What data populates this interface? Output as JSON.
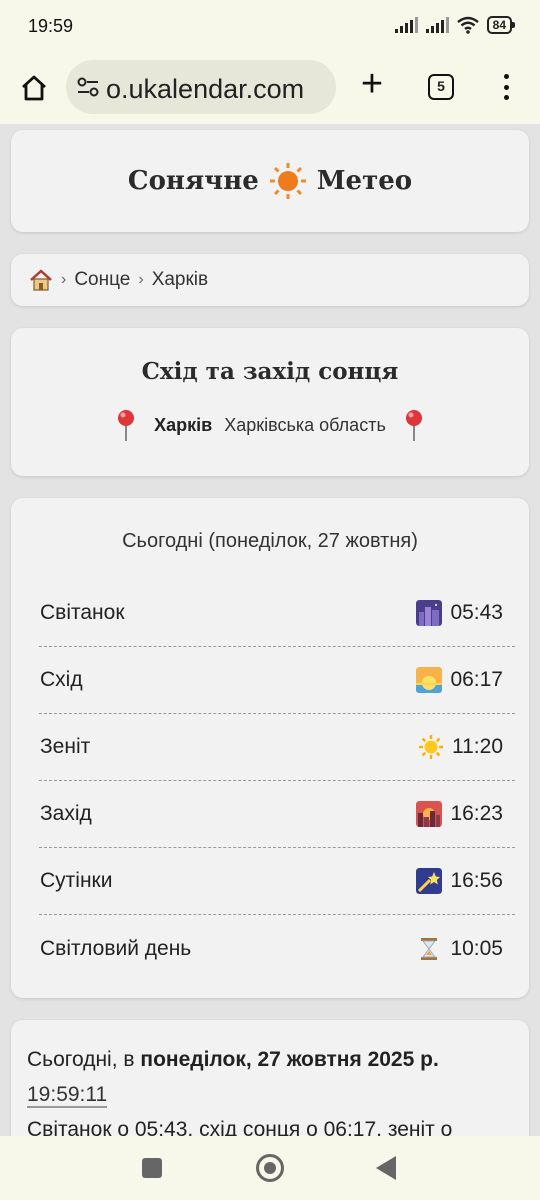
{
  "status": {
    "time": "19:59",
    "battery": "84"
  },
  "browser": {
    "url": "o.ukalendar.com",
    "tab_count": "5"
  },
  "site": {
    "name_left": "Сонячне",
    "name_right": "Метео"
  },
  "breadcrumb": {
    "items": [
      "Сонце",
      "Харків"
    ],
    "separator": "›"
  },
  "header": {
    "title": "Схід та захід сонця",
    "city": "Харків",
    "region": "Харківська область"
  },
  "today": {
    "heading": "Сьогодні (понеділок, 27 жовтня)",
    "rows": [
      {
        "label": "Світанок",
        "time": "05:43",
        "icon": "night-city-icon"
      },
      {
        "label": "Схід",
        "time": "06:17",
        "icon": "sunrise-icon"
      },
      {
        "label": "Зеніт",
        "time": "11:20",
        "icon": "sun-icon"
      },
      {
        "label": "Захід",
        "time": "16:23",
        "icon": "sunset-city-icon"
      },
      {
        "label": "Сутінки",
        "time": "16:56",
        "icon": "shooting-star-icon"
      },
      {
        "label": "Світловий день",
        "time": "10:05",
        "icon": "hourglass-icon"
      }
    ]
  },
  "summary": {
    "prefix": "Сьогодні, в ",
    "date_bold": "понеділок, 27 жовтня 2025 р.",
    "clock": "19:59:11",
    "text": "Світанок о 05:43, схід сонця о 06:17, зеніт о"
  },
  "colors": {
    "chrome_bg": "#f7f7ea",
    "page_bg": "#e3e3e3",
    "card_bg": "#f2f2f2",
    "sun_orange": "#f07b1c"
  }
}
